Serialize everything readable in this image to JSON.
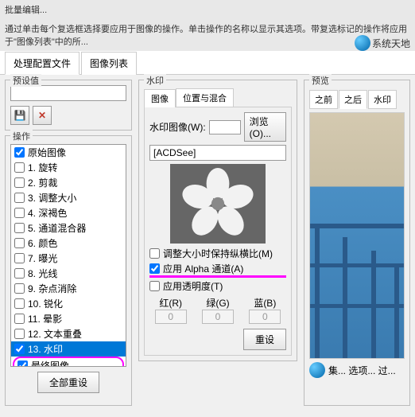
{
  "header": {
    "title_fragment": "批量编辑...",
    "hint": "通过单击每个复选框选择要应用于图像的操作。单击操作的名称以显示其选项。带复选标记的操作将应用于\"图像列表\"中的所..."
  },
  "main_tabs": {
    "t0": "处理配置文件",
    "t1": "图像列表"
  },
  "preset": {
    "legend": "预设值",
    "dropdown_value": ""
  },
  "icons": {
    "save": "💾",
    "delete": "✕"
  },
  "ops": {
    "legend": "操作",
    "items": [
      {
        "label": "原始图像",
        "checked": true
      },
      {
        "label": "1. 旋转",
        "checked": false
      },
      {
        "label": "2. 剪裁",
        "checked": false
      },
      {
        "label": "3. 调整大小",
        "checked": false
      },
      {
        "label": "4. 深褐色",
        "checked": false
      },
      {
        "label": "5. 通道混合器",
        "checked": false
      },
      {
        "label": "6. 颜色",
        "checked": false
      },
      {
        "label": "7. 曝光",
        "checked": false
      },
      {
        "label": "8. 光线",
        "checked": false
      },
      {
        "label": "9. 杂点消除",
        "checked": false
      },
      {
        "label": "10. 锐化",
        "checked": false
      },
      {
        "label": "11. 晕影",
        "checked": false
      },
      {
        "label": "12. 文本重叠",
        "checked": false
      },
      {
        "label": "13. 水印",
        "checked": true,
        "selected": true
      },
      {
        "label": "最终图像",
        "checked": true,
        "highlight": true
      }
    ],
    "reset_all": "全部重设"
  },
  "watermark": {
    "legend": "水印",
    "tabs": {
      "t0": "图像",
      "t1": "位置与混合"
    },
    "image_label": "水印图像(W):",
    "browse": "浏览(O)...",
    "dropdown_value": "[ACDSee]",
    "keep_ratio": "调整大小时保持纵横比(M)",
    "use_alpha": "应用 Alpha 通道(A)",
    "use_opacity": "应用透明度(T)",
    "rgb": {
      "r": "红(R)",
      "g": "绿(G)",
      "b": "蓝(B)",
      "rv": "0",
      "gv": "0",
      "bv": "0"
    },
    "reset": "重设"
  },
  "preview": {
    "legend": "预览",
    "tabs": {
      "t0": "之前",
      "t1": "之后",
      "t2": "水印"
    },
    "bottom": "集...  选项...  过..."
  },
  "brand": "系统天地"
}
